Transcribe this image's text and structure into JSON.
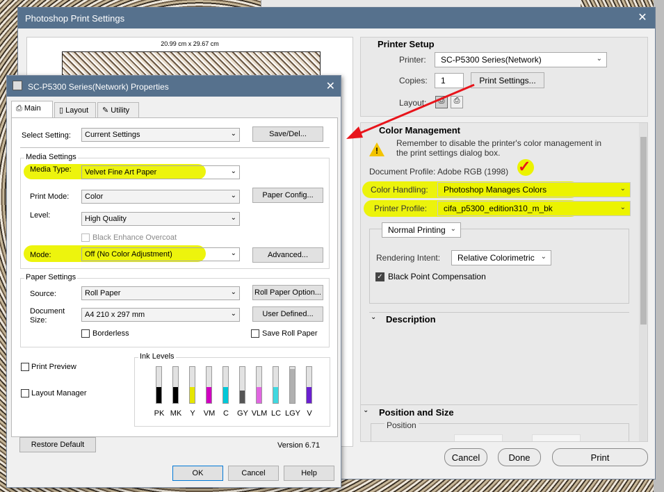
{
  "ps_window": {
    "title": "Photoshop Print Settings",
    "paper_dimensions": "20.99 cm x 29.67 cm",
    "printer_setup": {
      "title": "Printer Setup",
      "printer_label": "Printer:",
      "printer_value": "SC-P5300 Series(Network)",
      "copies_label": "Copies:",
      "copies_value": "1",
      "print_settings_button": "Print Settings...",
      "layout_label": "Layout:"
    },
    "color_management": {
      "title": "Color Management",
      "warning": "Remember to disable the printer's color management in the print settings dialog box.",
      "document_profile": "Document Profile: Adobe RGB (1998)",
      "color_handling_label": "Color Handling:",
      "color_handling_value": "Photoshop Manages Colors",
      "printer_profile_label": "Printer Profile:",
      "printer_profile_value": "cifa_p5300_edition310_m_bk",
      "normal_printing": "Normal Printing",
      "rendering_intent_label": "Rendering Intent:",
      "rendering_intent_value": "Relative Colorimetric",
      "black_point_label": "Black Point Compensation"
    },
    "description_title": "Description",
    "position_size_title": "Position and Size",
    "position_label": "Position",
    "buttons": {
      "cancel": "Cancel",
      "done": "Done",
      "print": "Print"
    }
  },
  "epson": {
    "title": "SC-P5300 Series(Network) Properties",
    "tabs": [
      "Main",
      "Layout",
      "Utility"
    ],
    "select_setting_label": "Select Setting:",
    "select_setting_value": "Current Settings",
    "save_del": "Save/Del...",
    "media_settings_label": "Media Settings",
    "media_type_label": "Media Type:",
    "media_type_value": "Velvet Fine Art Paper",
    "print_mode_label": "Print Mode:",
    "print_mode_value": "Color",
    "paper_config": "Paper Config...",
    "level_label": "Level:",
    "level_value": "High Quality",
    "black_enhance": "Black Enhance Overcoat",
    "mode_label": "Mode:",
    "mode_value": "Off (No Color Adjustment)",
    "advanced": "Advanced...",
    "paper_settings_label": "Paper Settings",
    "source_label": "Source:",
    "source_value": "Roll Paper",
    "roll_paper_option": "Roll Paper Option...",
    "document_label": "Document",
    "size_label": "Size:",
    "document_size_value": "A4 210 x 297 mm",
    "user_defined": "User Defined...",
    "borderless": "Borderless",
    "save_roll_paper": "Save Roll Paper",
    "print_preview": "Print Preview",
    "layout_manager": "Layout Manager",
    "ink_levels_label": "Ink Levels",
    "inks": [
      {
        "name": "PK",
        "color": "#000000",
        "level": 0.45
      },
      {
        "name": "MK",
        "color": "#000000",
        "level": 0.45
      },
      {
        "name": "Y",
        "color": "#e6e600",
        "level": 0.45
      },
      {
        "name": "VM",
        "color": "#d000c0",
        "level": 0.45
      },
      {
        "name": "C",
        "color": "#00c8d8",
        "level": 0.45
      },
      {
        "name": "GY",
        "color": "#555555",
        "level": 0.35
      },
      {
        "name": "VLM",
        "color": "#e066e0",
        "level": 0.45
      },
      {
        "name": "LC",
        "color": "#40d8e0",
        "level": 0.45
      },
      {
        "name": "LGY",
        "color": "#b0b0b0",
        "level": 0.95
      },
      {
        "name": "V",
        "color": "#6a1fd0",
        "level": 0.45
      }
    ],
    "restore_default": "Restore Default",
    "version": "Version 6.71",
    "ok": "OK",
    "cancel": "Cancel",
    "help": "Help"
  },
  "colors": {
    "highlight": "#ecf300",
    "arrow": "#e8141b",
    "titlebar": "#56718d"
  }
}
